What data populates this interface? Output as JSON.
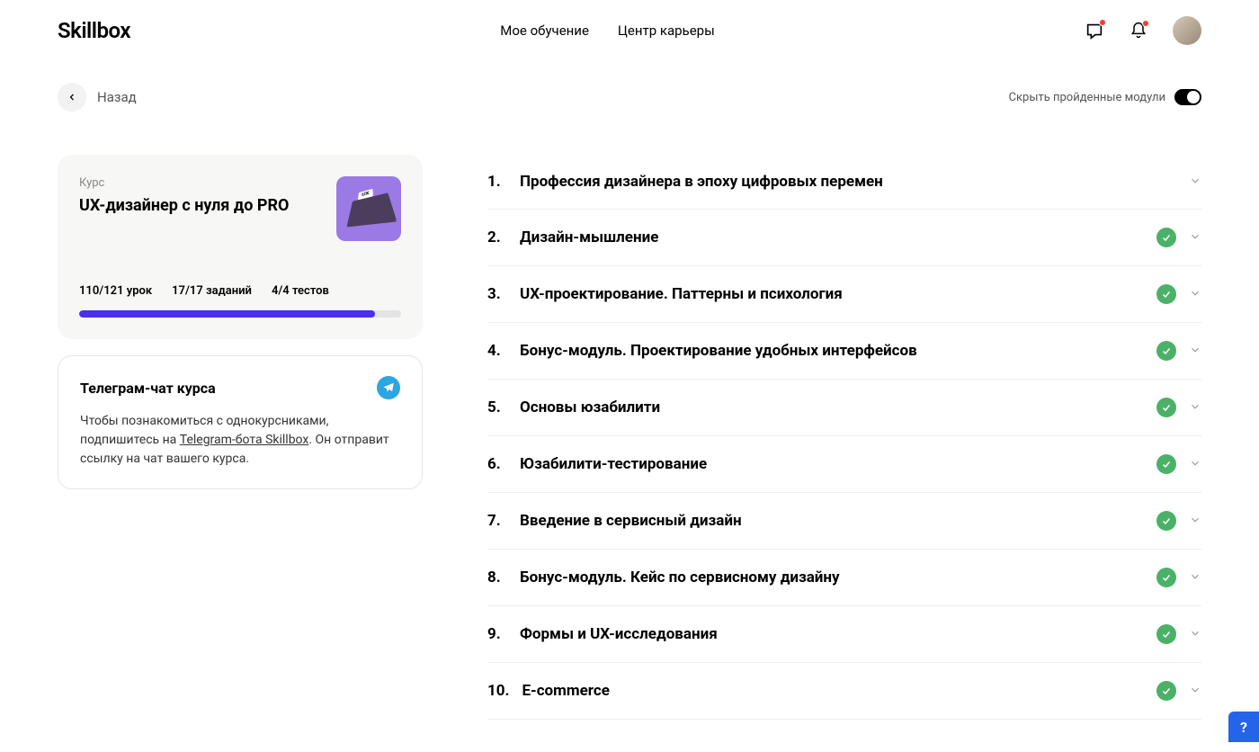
{
  "header": {
    "logo": "Skillbox",
    "nav": {
      "learning": "Мое обучение",
      "career": "Центр карьеры"
    }
  },
  "topbar": {
    "back": "Назад",
    "toggle_label": "Скрыть пройденные модули"
  },
  "course": {
    "label": "Курс",
    "title": "UX-дизайнер с нуля до PRO",
    "stats": {
      "lessons": "110/121 урок",
      "tasks": "17/17 заданий",
      "tests": "4/4 тестов"
    },
    "progress_percent": 92
  },
  "telegram": {
    "title": "Телеграм-чат курса",
    "text_before": "Чтобы познакомиться с однокурсниками, подпишитесь на ",
    "link": "Telegram-бота Skillbox",
    "text_after": ". Он отправит ссылку на чат вашего курса."
  },
  "modules": [
    {
      "num": "1.",
      "title": "Профессия дизайнера в эпоху цифровых перемен",
      "completed": false
    },
    {
      "num": "2.",
      "title": "Дизайн-мышление",
      "completed": true
    },
    {
      "num": "3.",
      "title": "UX-проектирование. Паттерны и психология",
      "completed": true
    },
    {
      "num": "4.",
      "title": "Бонус-модуль. Проектирование удобных интерфейсов",
      "completed": true
    },
    {
      "num": "5.",
      "title": "Основы юзабилити",
      "completed": true
    },
    {
      "num": "6.",
      "title": "Юзабилити-тестирование",
      "completed": true
    },
    {
      "num": "7.",
      "title": "Введение в сервисный дизайн",
      "completed": true
    },
    {
      "num": "8.",
      "title": "Бонус-модуль. Кейс по сервисному дизайну",
      "completed": true
    },
    {
      "num": "9.",
      "title": "Формы и UX-исследования",
      "completed": true
    },
    {
      "num": "10.",
      "title": "E-commerce",
      "completed": true
    }
  ],
  "help": "?"
}
